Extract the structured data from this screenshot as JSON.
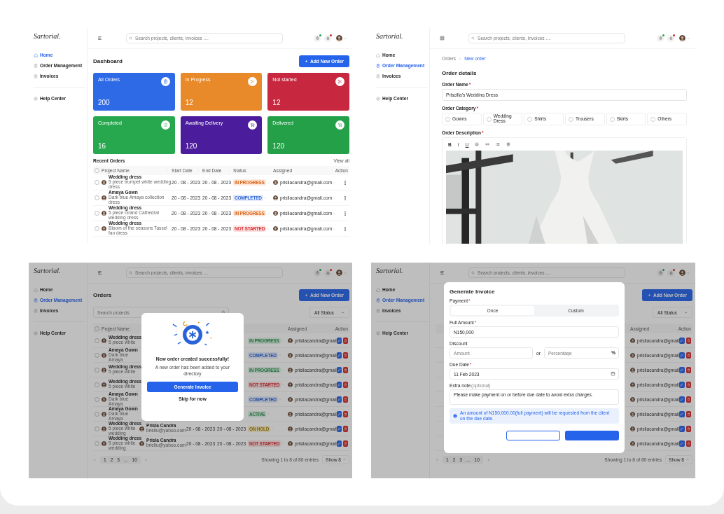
{
  "screens": [
    {
      "kind": "dashboard",
      "logo": "Sartorial.",
      "nav": [
        {
          "label": "Home",
          "selected": true
        },
        {
          "label": "Order Management",
          "selected": false
        },
        {
          "label": "Invoices",
          "selected": false
        },
        {
          "label": "Help Center",
          "selected": false
        }
      ],
      "search": {
        "placeholder": "Search projects, clients, invoices ...."
      },
      "title": "Dashboard",
      "add_button": "Add New Order",
      "stats": [
        {
          "label": "All Orders",
          "value": "200",
          "color": "#2f6ae6"
        },
        {
          "label": "In Progress",
          "value": "12",
          "color": "#e88a2a"
        },
        {
          "label": "Not started",
          "value": "12",
          "color": "#c8283f"
        },
        {
          "label": "Completed",
          "value": "16",
          "color": "#27a84e"
        },
        {
          "label": "Awaiting Delivery",
          "value": "120",
          "color": "#4b1c9c"
        },
        {
          "label": "Delivered",
          "value": "120",
          "color": "#23a048"
        }
      ],
      "section_title": "Recent Orders",
      "view_all": "View all",
      "table": {
        "checked": false,
        "columns": [
          {
            "kind": "project",
            "label": "Project Name",
            "sortable": true
          },
          {
            "kind": "start",
            "label": "Start Date",
            "sortable": true
          },
          {
            "kind": "end",
            "label": "End Date",
            "sortable": true
          },
          {
            "kind": "status",
            "label": "Status",
            "sortable": false
          },
          {
            "kind": "assigned",
            "label": "Assigned",
            "sortable": false
          },
          {
            "kind": "action",
            "label": "Action",
            "sortable": false
          }
        ],
        "rows": [
          {
            "checked": false,
            "name": "Wedding dress",
            "subtitle": "5 piece trumpet white wedding dress",
            "start": "20 - 08 - 2023",
            "end": "20 - 08 - 2023",
            "status": {
              "label": "IN PROGRESS",
              "kind": "progress"
            },
            "assignee": "prisliacandra@gmail.com"
          },
          {
            "checked": false,
            "name": "Amaya Gown",
            "subtitle": "Dark blue Amaya collection dress",
            "start": "20 - 08 - 2023",
            "end": "20 - 08 - 2023",
            "status": {
              "label": "COMPLETED",
              "kind": "completed"
            },
            "assignee": "prisliacandra@gmail.com"
          },
          {
            "checked": false,
            "name": "Wedding dress",
            "subtitle": "5 piece Grand Cathedral wedding dress",
            "start": "20 - 08 - 2023",
            "end": "20 - 08 - 2023",
            "status": {
              "label": "IN PROGRESS",
              "kind": "progress"
            },
            "assignee": "prisliacandra@gmail.com"
          },
          {
            "checked": false,
            "name": "Wedding dress",
            "subtitle": "Bloom of the seasons Tassel fan dress",
            "start": "20 - 08 - 2023",
            "end": "20 - 08 - 2023",
            "status": {
              "label": "NOT STARTED",
              "kind": "not_started"
            },
            "assignee": "prisliacandra@gmail.com"
          }
        ]
      }
    },
    {
      "kind": "order_form",
      "logo": "Sartorial.",
      "nav": [
        {
          "label": "Home",
          "selected": false
        },
        {
          "label": "Order Management",
          "selected": true
        },
        {
          "label": "Invoices",
          "selected": false
        },
        {
          "label": "Help Center",
          "selected": false
        }
      ],
      "search": {
        "placeholder": "Search projects, clients, invoices ...."
      },
      "breadcrumb": [
        {
          "label": "Orders",
          "selected": false
        },
        {
          "label": "New order",
          "selected": true
        }
      ],
      "title": "Order details",
      "fields": [
        {
          "kind": "text",
          "label": "Order Name",
          "mark": "*",
          "value": "Priscilla's Wedding Dress"
        },
        {
          "kind": "choice",
          "label": "Order Category",
          "mark": "*",
          "options": [
            {
              "label": "Gowns",
              "selected": false
            },
            {
              "label": "Wedding Dress",
              "selected": false
            },
            {
              "label": "Shirts",
              "selected": false
            },
            {
              "label": "Trousers",
              "selected": false
            },
            {
              "label": "Skirts",
              "selected": false
            },
            {
              "label": "Others",
              "selected": false
            }
          ]
        },
        {
          "kind": "editor",
          "label": "Order Description",
          "mark": "*",
          "toolbar": [
            "B",
            "I",
            "U"
          ],
          "content": {
            "kind": "picture"
          }
        }
      ]
    },
    {
      "kind": "orders",
      "logo": "Sartorial.",
      "nav": [
        {
          "label": "Home",
          "selected": false
        },
        {
          "label": "Order Management",
          "selected": true
        },
        {
          "label": "Invoices",
          "selected": false
        },
        {
          "label": "Help Center",
          "selected": false
        }
      ],
      "search": {
        "placeholder": "Search projects, clients, invoices ...."
      },
      "title": "Orders",
      "add_button": "Add New Order",
      "table_search": {
        "placeholder": "Search projects"
      },
      "filter": "All Status",
      "table": {
        "checked": false,
        "columns": [
          {
            "kind": "project",
            "label": "Project Name"
          },
          {
            "kind": "assigned",
            "label": "Assigned"
          },
          {
            "kind": "action",
            "label": "Action"
          }
        ],
        "rows": [
          {
            "checked": false,
            "name": "Wedding dress",
            "subtitle": "5 piece white",
            "status": {
              "label": "IN PROGRESS",
              "kind": "ongoing"
            },
            "assignee": "prisliacandra@gmail"
          },
          {
            "checked": false,
            "name": "Amaya Gown",
            "subtitle": "Dark blue Amaya",
            "status": {
              "label": "COMPLETED",
              "kind": "completed"
            },
            "assignee": "prisliacandra@gmail"
          },
          {
            "checked": false,
            "name": "Wedding dress",
            "subtitle": "5 piece white",
            "status": {
              "label": "IN PROGRESS",
              "kind": "ongoing"
            },
            "assignee": "prisliacandra@gmail"
          },
          {
            "checked": false,
            "name": "Wedding dress",
            "subtitle": "5 piece white",
            "status": {
              "label": "NOT STARTED",
              "kind": "not_started"
            },
            "assignee": "prisliacandra@gmail"
          },
          {
            "checked": false,
            "name": "Amaya Gown",
            "subtitle": "Dark blue Amaya",
            "status": {
              "label": "COMPLETED",
              "kind": "completed"
            },
            "assignee": "prisliacandra@gmail"
          },
          {
            "checked": false,
            "name": "Amaya Gown",
            "subtitle": "Dark blue Amaya",
            "status": {
              "label": "ACTIVE",
              "kind": "active"
            },
            "assignee": "prisliacandra@gmail"
          },
          {
            "checked": false,
            "name": "Wedding dress",
            "subtitle": "5 piece white wedding",
            "client": "Prisla Candra",
            "client_email": "briellu@yahoo.com",
            "start": "20 - 08 - 2023",
            "end": "20 - 08 - 2023",
            "status": {
              "label": "ON HOLD",
              "kind": "on_hold"
            },
            "assignee": "prisliacandra@gmail"
          },
          {
            "checked": false,
            "name": "Wedding dress",
            "subtitle": "5 piece white wedding",
            "client": "Prisla Candra",
            "client_email": "briellu@yahoo.com",
            "start": "20 - 08 - 2023",
            "end": "20 - 08 - 2023",
            "status": {
              "label": "NOT STARTED",
              "kind": "not_started"
            },
            "assignee": "prisliacandra@gmail"
          }
        ]
      },
      "pagination": {
        "pages": [
          "1",
          "2",
          "3",
          "...",
          "10"
        ],
        "summary": "Showing 1 to 8 of 80 entries",
        "page_size": "Show 8"
      },
      "modal": {
        "kind": "success",
        "title": "New order created successfully!",
        "message": "A new order has been added to your directory",
        "primary": "Generate Invoice",
        "secondary": "Skip for now"
      }
    },
    {
      "kind": "orders",
      "logo": "Sartorial.",
      "nav": [
        {
          "label": "Home",
          "selected": false
        },
        {
          "label": "Order Management",
          "selected": true
        },
        {
          "label": "Invoices",
          "selected": false
        },
        {
          "label": "Help Center",
          "selected": false
        }
      ],
      "search": {
        "placeholder": "Search projects, clients, invoices ...."
      },
      "add_button": "Add New Order",
      "filter": "All Status",
      "table": {
        "columns": [
          {
            "kind": "assigned",
            "label": "Assigned"
          },
          {
            "kind": "action",
            "label": "Action"
          }
        ],
        "rows": [
          {
            "assignee": "prisliacandra@gmail"
          },
          {
            "assignee": "prisliacandra@gmail"
          },
          {
            "assignee": "prisliacandra@gmail"
          },
          {
            "assignee": "prisliacandra@gmail"
          },
          {
            "assignee": "prisliacandra@gmail"
          },
          {
            "assignee": "prisliacandra@gmail"
          },
          {
            "assignee": "prisliacandra@gmail"
          },
          {
            "assignee": "prisliacandra@gmail"
          }
        ]
      },
      "pagination": {
        "pages": [
          "1",
          "2",
          "3",
          "...",
          "10"
        ],
        "summary": "Showing 1 to 8 of 80 entries",
        "page_size": "Show 8"
      },
      "modal": {
        "kind": "invoice",
        "title": "Generate Invoice",
        "payment": {
          "label": "Payment",
          "mark": "*",
          "options": [
            {
              "label": "Once",
              "selected": true
            },
            {
              "label": "Custom",
              "selected": false
            }
          ]
        },
        "full_amount": {
          "label": "Full Amount",
          "mark": "*",
          "value": "N150,000"
        },
        "discount": {
          "label": "Discount",
          "amount_placeholder": "Amount",
          "separator": "or",
          "percent_placeholder": "Percentage",
          "unit": "%"
        },
        "due_date": {
          "label": "Due Date",
          "mark": "*",
          "value": "11 Feb 2023"
        },
        "note": {
          "label": "Extra note",
          "hint": "(optional)",
          "value": "Please make payment on or before due date to avoid extra charges."
        },
        "info": "An amount of N150,000.00(full payment) will be requested from the client on the due date."
      }
    }
  ]
}
